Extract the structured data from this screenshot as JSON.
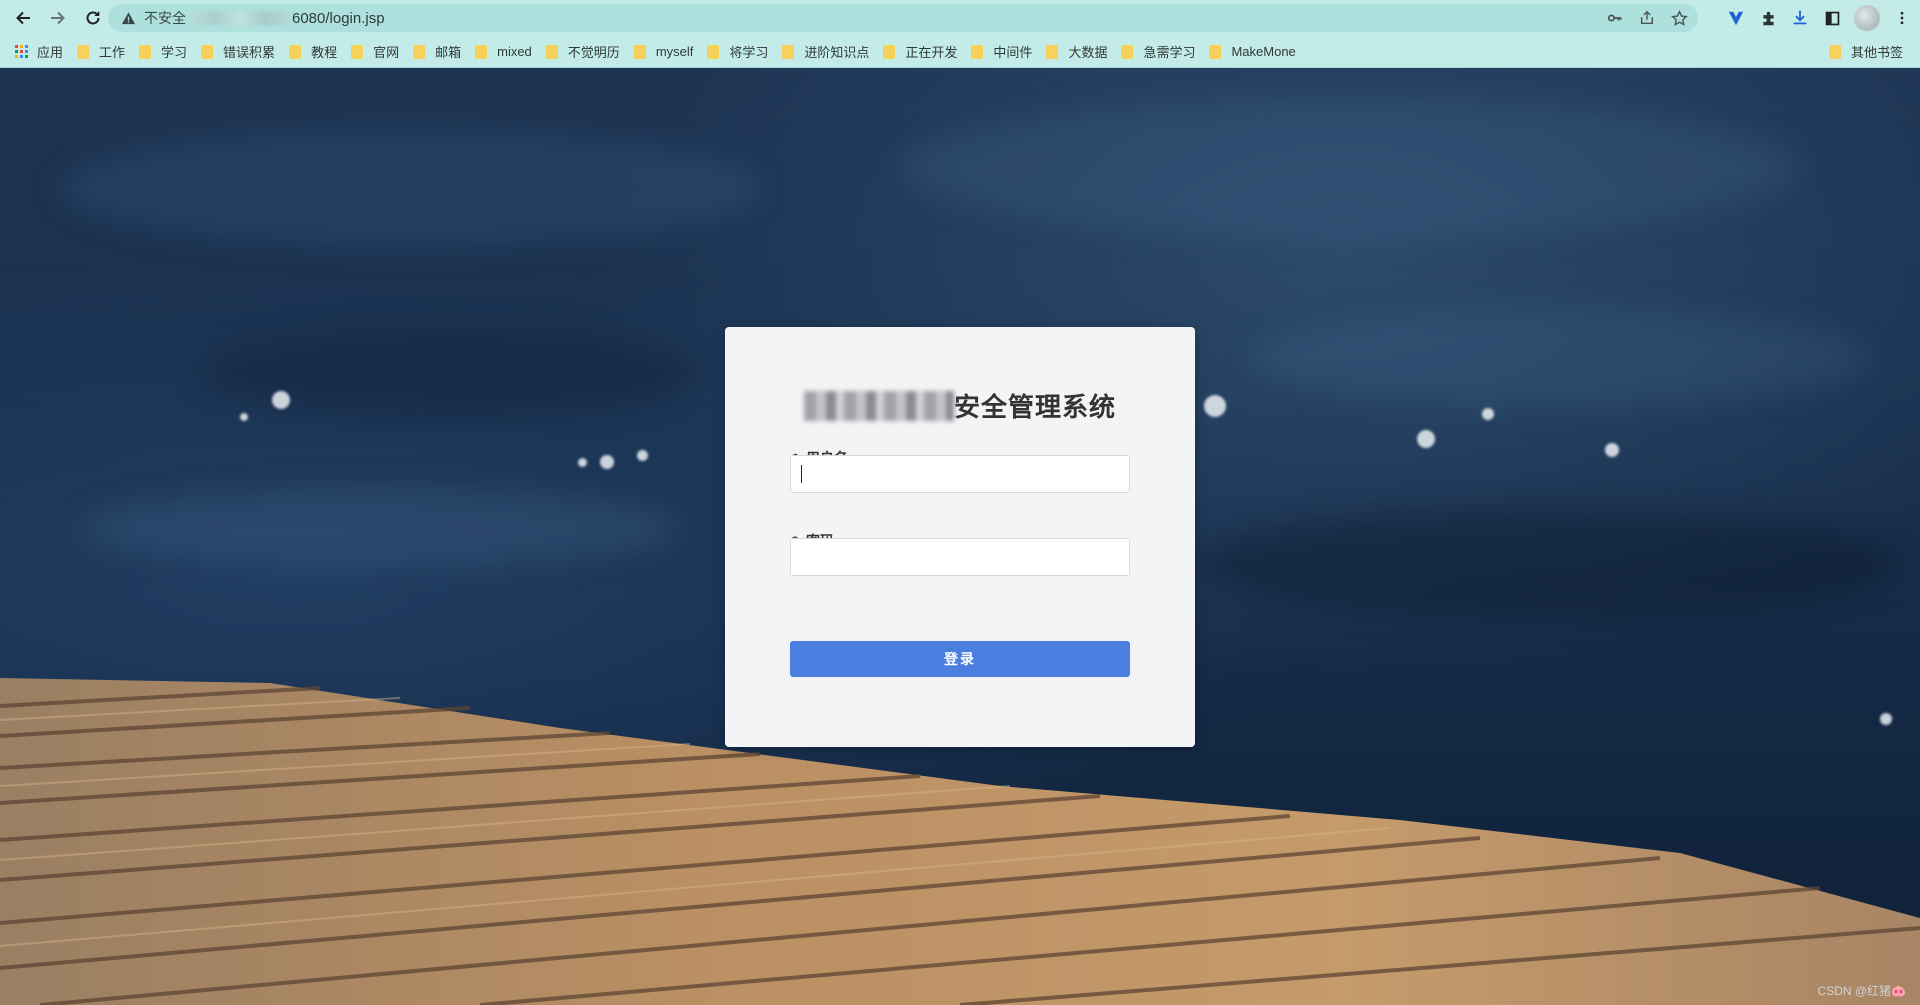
{
  "browser": {
    "address_bar": {
      "security_label": "不安全",
      "url_visible": "6080/login.jsp"
    },
    "bookmarks": {
      "apps_label": "应用",
      "folders": [
        "工作",
        "学习",
        "错误积累",
        "教程",
        "官网",
        "邮箱",
        "mixed",
        "不觉明历",
        "myself",
        "将学习",
        "进阶知识点",
        "正在开发",
        "中间件",
        "大数据",
        "急需学习",
        "MakeMone"
      ],
      "other_label": "其他书签"
    },
    "icons": {
      "back": "back-arrow-icon",
      "forward": "forward-arrow-icon",
      "reload": "reload-icon",
      "warning": "warning-triangle-icon",
      "key": "key-icon",
      "share": "share-icon",
      "star": "bookmark-star-icon",
      "extension_v": "vue-devtools-icon",
      "extensions": "puzzle-icon",
      "download": "download-icon",
      "sidepanel": "side-panel-icon",
      "menu": "kebab-menu-icon"
    }
  },
  "login": {
    "title_suffix": "安全管理系统",
    "username_label": "用户名:",
    "password_label": "密码:",
    "username_value": "",
    "password_value": "",
    "submit_label": "登录"
  },
  "watermark": "CSDN @红猪🐽",
  "colors": {
    "chrome_bg": "#c3ece9",
    "omnibox_bg": "#aee0dd",
    "card_bg": "#f3f4f6",
    "primary_button": "#4a7fe0",
    "folder": "#f6d25a"
  }
}
